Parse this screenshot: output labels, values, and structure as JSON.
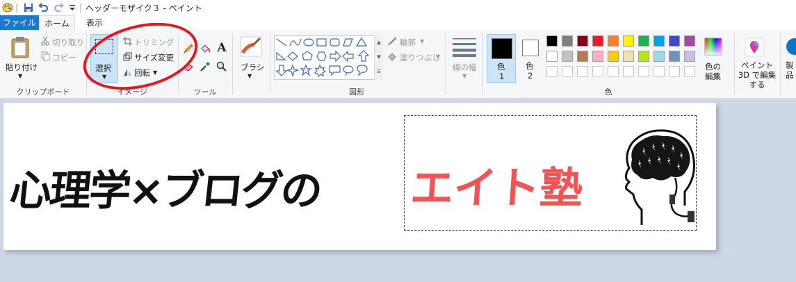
{
  "window": {
    "title": "ヘッダーモザイク３ - ペイント"
  },
  "tabs": {
    "file": "ファイル",
    "home": "ホーム",
    "view": "表示"
  },
  "clipboard": {
    "paste": "貼り付け",
    "cut": "切り取り",
    "copy": "コピー",
    "group": "クリップボード"
  },
  "image": {
    "select": "選択",
    "crop": "トリミング",
    "resize": "サイズ変更",
    "rotate": "回転",
    "group": "イメージ"
  },
  "tools": {
    "group": "ツール"
  },
  "brush": {
    "label": "ブラシ"
  },
  "shapes": {
    "outline": "輪郭",
    "fill": "塗りつぶし",
    "group": "図形"
  },
  "size": {
    "label": "線の幅"
  },
  "colors": {
    "color1": "色",
    "color1_num": "1",
    "color2": "色",
    "color2_num": "2",
    "edit": "色の編集",
    "group": "色",
    "palette_row1": [
      "#000000",
      "#7f7f7f",
      "#880015",
      "#ed1c24",
      "#ff7f27",
      "#fff200",
      "#22b14c",
      "#00a2e8",
      "#3f48cc",
      "#a349a4"
    ],
    "palette_row2": [
      "#ffffff",
      "#c3c3c3",
      "#b97a57",
      "#ffaec9",
      "#ffc90e",
      "#efe4b0",
      "#b5e61d",
      "#99d9ea",
      "#7092be",
      "#c8bfe7"
    ]
  },
  "paint3d": {
    "label": "ペイント 3D で編集する"
  },
  "product": {
    "label": "製品の警告"
  },
  "canvas": {
    "text_black": "心理学×ブログの",
    "text_red": "エイト塾"
  }
}
